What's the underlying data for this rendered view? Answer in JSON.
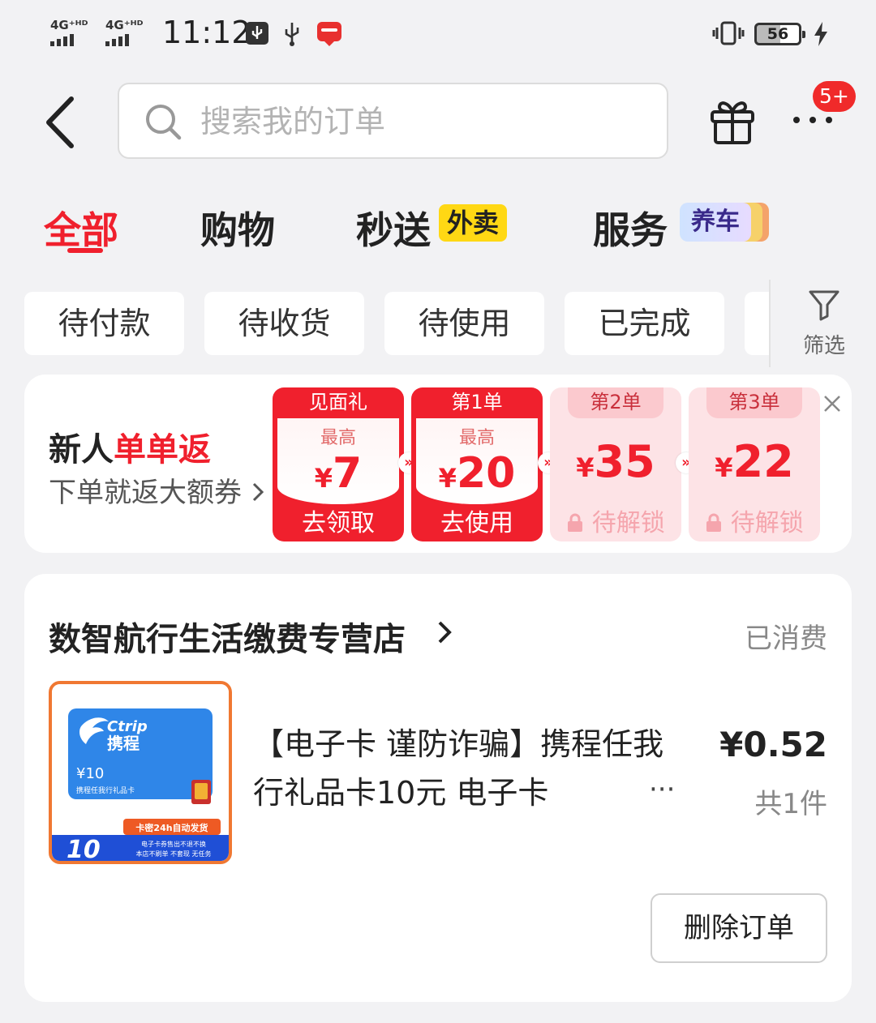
{
  "status_bar": {
    "net1": "4G⁺ᴴᴰ",
    "net2": "4G⁺ᴴᴰ",
    "time": "11:12",
    "battery": "56",
    "icons": [
      "usb-debug-icon",
      "usb-icon",
      "cloud-pay-app-icon",
      "vibrate-icon",
      "charging-icon"
    ]
  },
  "header": {
    "search_placeholder": "搜索我的订单",
    "more_badge": "5+"
  },
  "tabs": [
    {
      "label": "全部",
      "active": true
    },
    {
      "label": "购物"
    },
    {
      "label": "秒送",
      "tag": "外卖"
    },
    {
      "label": "服务",
      "tag": "养车"
    }
  ],
  "filters": {
    "chips": [
      "待付款",
      "待收货",
      "待使用",
      "已完成"
    ],
    "filter_label": "筛选"
  },
  "promo": {
    "title_prefix": "新人",
    "title_highlight": "单单返",
    "subtitle": "下单就返大额券",
    "coupons": [
      {
        "head": "见面礼",
        "max": "最高",
        "currency": "¥",
        "amount": "7",
        "action": "去领取",
        "state": "active"
      },
      {
        "head": "第1单",
        "max": "最高",
        "currency": "¥",
        "amount": "20",
        "action": "去使用",
        "state": "active"
      },
      {
        "head": "第2单",
        "currency": "¥",
        "amount": "35",
        "action": "待解锁",
        "state": "locked"
      },
      {
        "head": "第3单",
        "currency": "¥",
        "amount": "22",
        "action": "待解锁",
        "state": "locked"
      }
    ],
    "accent_color": "#f0202d"
  },
  "order": {
    "store": "数智航行生活缴费专营店",
    "status": "已消费",
    "product_name": "【电子卡  谨防诈骗】携程任我行礼品卡10元  电子卡",
    "price": "¥0.52",
    "quantity": "共1件",
    "delete_label": "删除订单",
    "thumb": {
      "brand": "Ctrip",
      "brand_cn": "携程",
      "card_value": "¥10",
      "card_name": "携程任我行礼品卡",
      "banner": "卡密24h自动发货",
      "big_num": "10",
      "note1": "电子卡券售出不退不换",
      "note2": "本店不刷单 不套现 无任务"
    }
  }
}
